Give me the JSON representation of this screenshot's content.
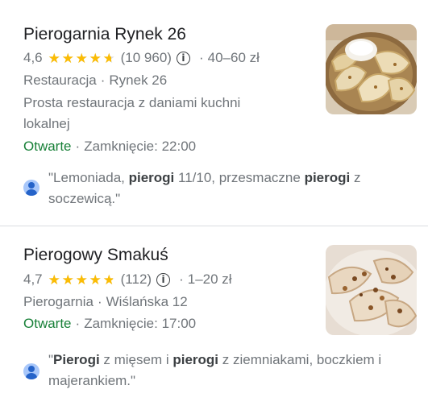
{
  "results": [
    {
      "name": "Pierogarnia Rynek 26",
      "rating": "4,6",
      "rating_value": 4.6,
      "reviews": "(10 960)",
      "price": "40–60 zł",
      "category": "Restauracja",
      "address": "Rynek 26",
      "description": "Prosta restauracja z daniami kuchni lokalnej",
      "status": "Otwarte",
      "hours": "Zamknięcie: 22:00",
      "review_parts": [
        "\"Lemoniada, ",
        "pierogi",
        " 11/10, przesmaczne ",
        "pierogi",
        " z soczewicą.\""
      ]
    },
    {
      "name": "Pierogowy Smakuś",
      "rating": "4,7",
      "rating_value": 4.7,
      "reviews": "(112)",
      "price": "1–20 zł",
      "category": "Pierogarnia",
      "address": "Wiślańska 12",
      "description": "",
      "status": "Otwarte",
      "hours": "Zamknięcie: 17:00",
      "review_parts": [
        "\"",
        "Pierogi",
        " z mięsem i ",
        "pierogi",
        " z ziemniakami, boczkiem i majerankiem.\""
      ]
    }
  ],
  "separator": "·",
  "colors": {
    "star": "#fbbc04",
    "open": "#188038",
    "muted": "#70757a"
  },
  "icons": {
    "info": "info-icon",
    "avatar": "user-avatar-icon",
    "star": "star-icon"
  }
}
